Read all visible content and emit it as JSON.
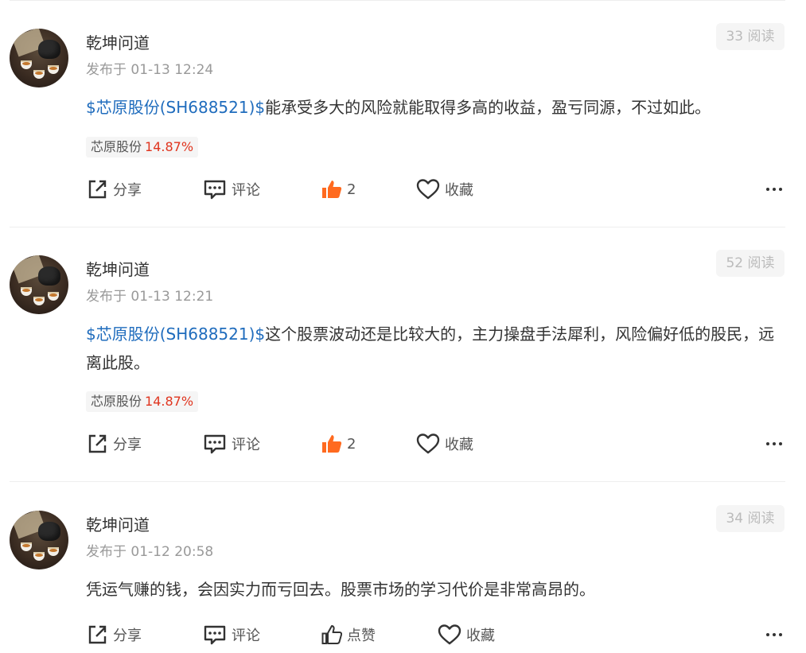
{
  "posts": [
    {
      "username": "乾坤问道",
      "time": "发布于 01-13 12:24",
      "reads": "33 阅读",
      "content_link": "$芯原股份(SH688521)$",
      "content_text": "能承受多大的风险就能取得多高的收益，盈亏同源，不过如此。",
      "stock_tag": {
        "name": "芯原股份",
        "change": "14.87%"
      },
      "actions": {
        "share": "分享",
        "comment": "评论",
        "like": "2",
        "like_active": true,
        "favorite": "收藏"
      }
    },
    {
      "username": "乾坤问道",
      "time": "发布于 01-13 12:21",
      "reads": "52 阅读",
      "content_link": "$芯原股份(SH688521)$",
      "content_text": "这个股票波动还是比较大的，主力操盘手法犀利，风险偏好低的股民，远离此股。",
      "stock_tag": {
        "name": "芯原股份",
        "change": "14.87%"
      },
      "actions": {
        "share": "分享",
        "comment": "评论",
        "like": "2",
        "like_active": true,
        "favorite": "收藏"
      }
    },
    {
      "username": "乾坤问道",
      "time": "发布于 01-12 20:58",
      "reads": "34 阅读",
      "content_link": "",
      "content_text": "凭运气赚的钱，会因实力而亏回去。股票市场的学习代价是非常高昂的。",
      "actions": {
        "share": "分享",
        "comment": "评论",
        "like": "点赞",
        "like_active": false,
        "favorite": "收藏"
      }
    }
  ],
  "colors": {
    "link": "#1f6cbd",
    "rise": "#e0351f",
    "like_active": "#ff6a1f"
  }
}
